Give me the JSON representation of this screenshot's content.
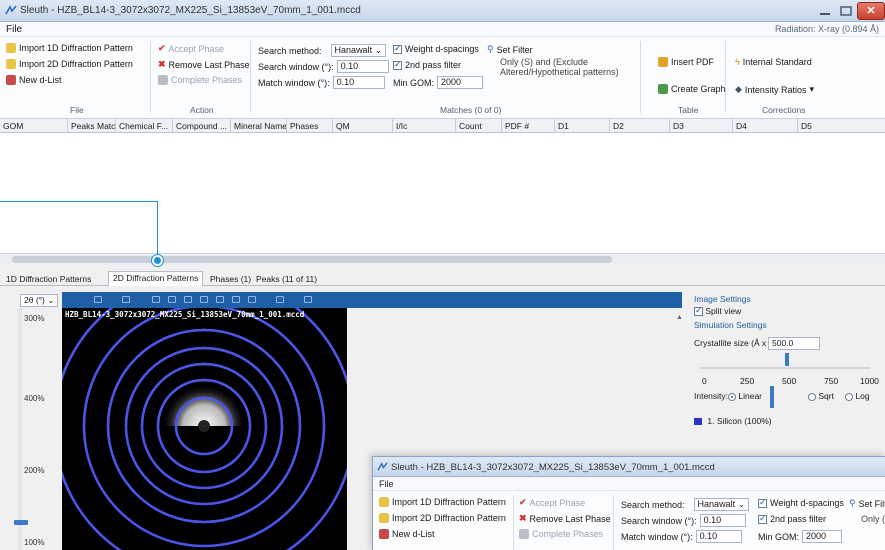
{
  "window": {
    "title": "Sleuth - HZB_BL14-3_3072x3072_MX225_Si_13853eV_70mm_1_001.mccd",
    "close_label": "✕",
    "menu": {
      "file": "File"
    },
    "radiation": "Radiation: X-ray (0.894 Å)"
  },
  "ribbon": {
    "file_group": {
      "label": "File",
      "import_1d": "Import 1D Diffraction Pattern",
      "import_2d": "Import 2D Diffraction Pattern",
      "new_d_list": "New d-List"
    },
    "action_group": {
      "label": "Action",
      "accept_phase": "Accept Phase",
      "remove_last_phase": "Remove Last Phase",
      "complete_phases": "Complete Phases"
    },
    "matches_group": {
      "label": "Matches (0 of 0)",
      "search_method_label": "Search method:",
      "search_method_value": "Hanawalt",
      "search_window_label": "Search window (°):",
      "search_window_value": "0.10",
      "match_window_label": "Match window (°):",
      "match_window_value": "0.10",
      "min_gom_label": "Min GOM:",
      "min_gom_value": "2000",
      "weight_d_spacings": "Weight d-spacings",
      "second_pass_filter": "2nd pass filter",
      "set_filter": "Set Filter",
      "filter_note": "Only (S) and (Exclude Altered/Hypothetical patterns)"
    },
    "table_group": {
      "label": "Table",
      "insert_pdf": "Insert PDF",
      "create_graph": "Create Graph"
    },
    "corrections_group": {
      "label": "Corrections",
      "internal_standard": "Internal Standard",
      "intensity_ratios": "Intensity Ratios"
    }
  },
  "table": {
    "columns": [
      "GOM",
      "Peaks Matc...",
      "Chemical F...",
      "Compound ...",
      "Mineral Name",
      "Phases",
      "QM",
      "I/Ic",
      "Count",
      "PDF #",
      "D1",
      "D2",
      "D3",
      "D4",
      "D5"
    ]
  },
  "tabs": [
    "1D Diffraction Patterns",
    "2D Diffraction Patterns",
    "Phases (1)",
    "Peaks (11 of 11)"
  ],
  "viewer": {
    "zoom": "2θ (°)",
    "image_caption": "HZB_BL14-3_3072x3072_MX225_Si_13853eV_70mm_1_001.mccd",
    "scale_labels": [
      "300%",
      "400%",
      "200%",
      "100%"
    ]
  },
  "settings": {
    "image_settings": "Image Settings",
    "split_view": "Split view",
    "simulation_settings": "Simulation Settings",
    "crystallite_size_label": "Crystallite size (Å x 1):",
    "crystallite_size_value": "500.0",
    "scale_ticks": [
      "0",
      "250",
      "500",
      "750",
      "1000"
    ],
    "intensity_label": "Intensity:",
    "linear": "Linear",
    "sqrt": "Sqrt",
    "log": "Log",
    "phase_entry": "1. Silicon (100%)",
    "phase_color": "#2a33c8"
  },
  "window2": {
    "title": "Sleuth - HZB_BL14-3_3072x3072_MX225_Si_13853eV_70mm_1_001.mccd",
    "menu_file": "File",
    "import_1d": "Import 1D Diffraction Pattern",
    "import_2d": "Import 2D Diffraction Pattern",
    "new_d_list": "New d-List",
    "accept_phase": "Accept Phase",
    "remove_last_phase": "Remove Last Phase",
    "complete_phases": "Complete Phases",
    "search_method_label": "Search method:",
    "search_method_value": "Hanawalt",
    "search_window_label": "Search window (°):",
    "search_window_value": "0.10",
    "match_window_label": "Match window (°):",
    "match_window_value": "0.10",
    "min_gom_label": "Min GOM:",
    "min_gom_value": "2000",
    "weight_d_spacings": "Weight d-spacings",
    "second_pass_filter": "2nd pass filter",
    "set_filter": "Set Filter",
    "filter_note": "Only (S)"
  },
  "colors": {
    "accent": "#1f5fa8",
    "callout": "#1f8fd6",
    "ring_blue": "#4a55e6",
    "ring_white": "#e8e8e8"
  }
}
